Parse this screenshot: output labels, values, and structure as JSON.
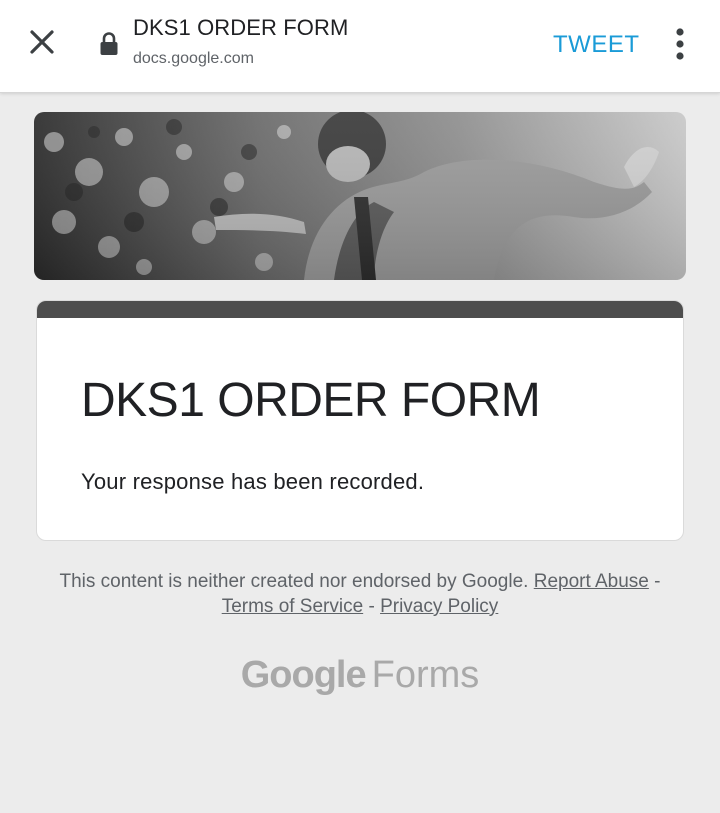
{
  "topbar": {
    "title": "DKS1 ORDER FORM",
    "url": "docs.google.com",
    "tweet_label": "TWEET",
    "icons": {
      "close": "close-icon",
      "lock": "lock-icon",
      "more": "more-vert-icon"
    }
  },
  "banner": {
    "image": "grayscale-header-photo"
  },
  "form": {
    "title": "DKS1 ORDER FORM",
    "confirmation": "Your response has been recorded.",
    "accent_color": "#4d4d4d"
  },
  "footer": {
    "disclaimer": "This content is neither created nor endorsed by Google.",
    "links": {
      "report_abuse": "Report Abuse",
      "terms": "Terms of Service",
      "privacy": "Privacy Policy"
    },
    "separator": "-"
  },
  "logo": {
    "google": "Google",
    "forms": "Forms"
  },
  "colors": {
    "tweet": "#1a9bd7",
    "background": "#ececec",
    "logo_gray": "#a9a9a9"
  }
}
